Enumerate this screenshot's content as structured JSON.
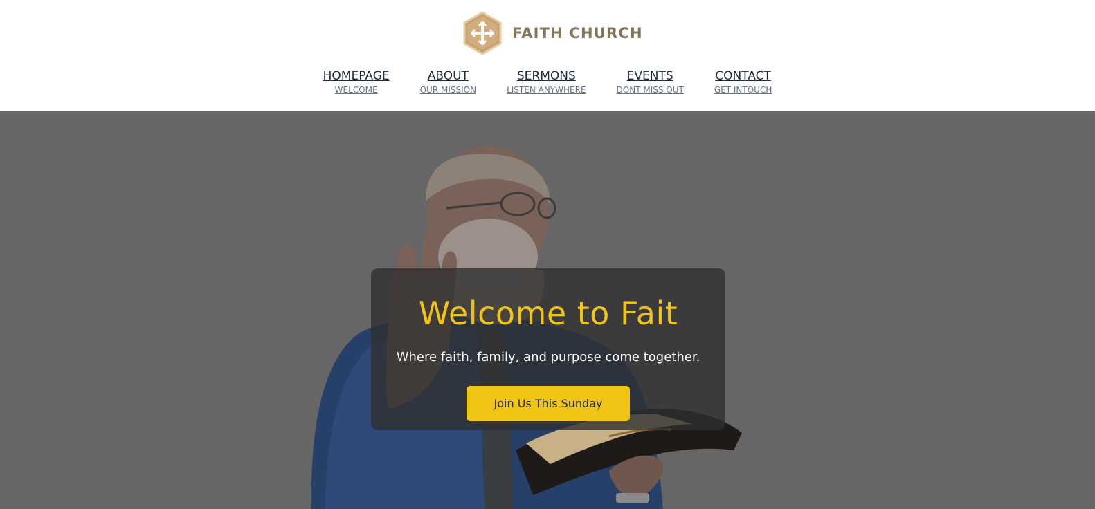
{
  "brand": {
    "name": "FAITH CHURCH",
    "logo_icon": "cross-hexagon-icon",
    "accent": "#c9a272"
  },
  "nav": {
    "items": [
      {
        "title": "HOMEPAGE",
        "subtitle": "WELCOME"
      },
      {
        "title": "ABOUT",
        "subtitle": "OUR MISSION"
      },
      {
        "title": "SERMONS",
        "subtitle": "LISTEN ANYWHERE"
      },
      {
        "title": "EVENTS",
        "subtitle": "DONT MISS OUT"
      },
      {
        "title": "CONTACT",
        "subtitle": "GET INTOUCH"
      }
    ]
  },
  "hero": {
    "title": "Welcome to Fait",
    "subtitle": "Where faith, family, and purpose come together.",
    "cta_label": "Join Us This Sunday",
    "title_color": "#f0c414",
    "button_color": "#f0c414"
  }
}
